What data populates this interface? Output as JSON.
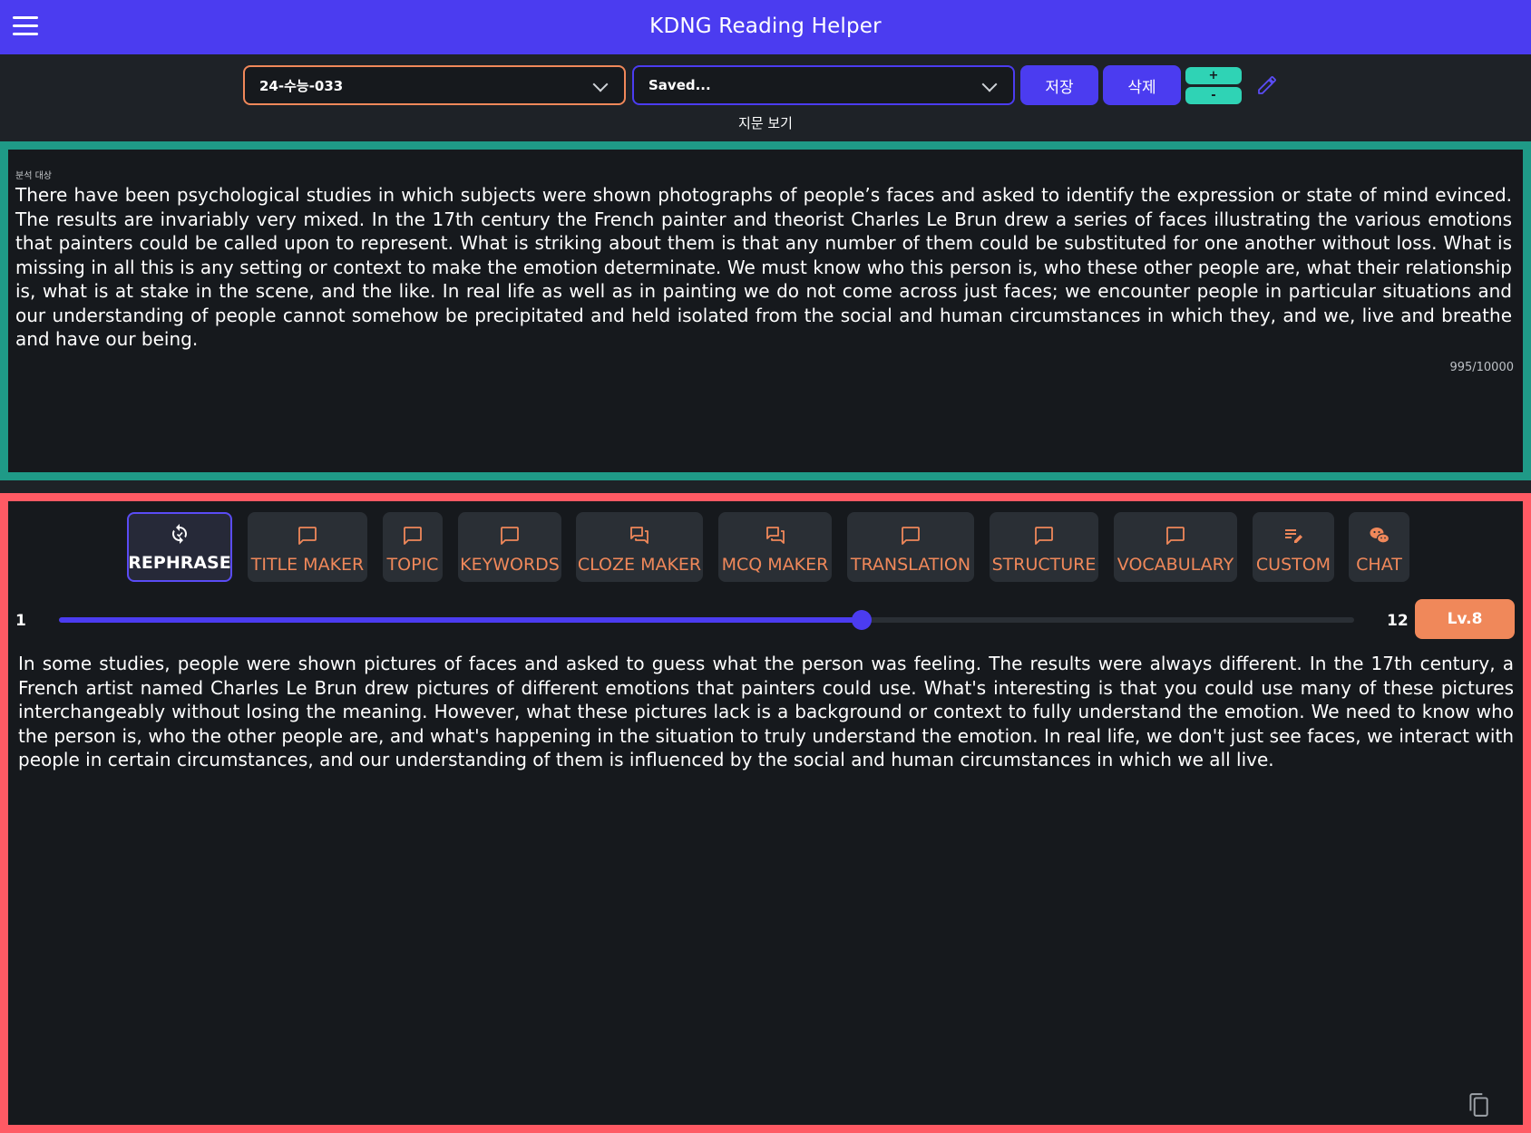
{
  "header": {
    "title": "KDNG Reading Helper",
    "menu_icon": "hamburger-menu-icon"
  },
  "toolbar": {
    "passage_select": {
      "value": "24-수능-033"
    },
    "saved_select": {
      "value": "Saved..."
    },
    "save_label": "저장",
    "delete_label": "삭제",
    "increase_label": "+",
    "decrease_label": "-",
    "edit_icon": "pencil-icon",
    "view_passage_label": "지문 보기"
  },
  "source": {
    "label": "분석 대상",
    "text": "There have been psychological studies in which subjects were shown photographs of people’s faces and asked to identify the expression or state of mind evinced. The results are invariably very mixed. In the 17th century the French painter and theorist Charles Le Brun drew a series of faces illustrating the various emotions that painters could be called upon to represent. What is striking about them is that any number of them could be substituted for one another without loss. What is missing in all this is any setting or context to make the emotion determinate. We must know who this person is, who these other people are, what their relationship is, what is at stake in the scene, and the like. In real life as well as in painting we do not come across just faces; we encounter people in particular situations and our understanding of people cannot somehow be precipitated and held isolated from the social and human circumstances in which they, and we, live and breathe and have our being.",
    "char_count": "995/10000"
  },
  "tabs": [
    {
      "label": "REPHRASE",
      "icon": "rephrase-sync-icon",
      "active": true
    },
    {
      "label": "TITLE MAKER",
      "icon": "chat-bubble-icon",
      "active": false
    },
    {
      "label": "TOPIC",
      "icon": "chat-bubble-icon",
      "active": false
    },
    {
      "label": "KEYWORDS",
      "icon": "chat-bubble-icon",
      "active": false
    },
    {
      "label": "CLOZE MAKER",
      "icon": "forum-icon",
      "active": false
    },
    {
      "label": "MCQ MAKER",
      "icon": "forum-icon",
      "active": false
    },
    {
      "label": "TRANSLATION",
      "icon": "chat-bubble-icon",
      "active": false
    },
    {
      "label": "STRUCTURE",
      "icon": "chat-bubble-icon",
      "active": false
    },
    {
      "label": "VOCABULARY",
      "icon": "chat-bubble-icon",
      "active": false
    },
    {
      "label": "CUSTOM",
      "icon": "edit-note-icon",
      "active": false
    },
    {
      "label": "CHAT",
      "icon": "wechat-icon",
      "active": false
    }
  ],
  "level_slider": {
    "min_label": "1",
    "max_label": "12",
    "min": 1,
    "max": 12,
    "value": 8,
    "badge": "Lv.8"
  },
  "output": {
    "text": "In some studies, people were shown pictures of faces and asked to guess what the person was feeling. The results were always different. In the 17th century, a French artist named Charles Le Brun drew pictures of different emotions that painters could use. What's interesting is that you could use many of these pictures interchangeably without losing the meaning. However, what these pictures lack is a background or context to fully understand the emotion. We need to know who the person is, who the other people are, and what's happening in the situation to truly understand the emotion. In real life, we don't just see faces, we interact with people in certain circumstances, and our understanding of them is influenced by the social and human circumstances in which we all live.",
    "copy_icon": "copy-icon"
  },
  "colors": {
    "brand": "#4b3cf0",
    "accent_orange": "#f0885a",
    "teal": "#1f9a87",
    "red": "#ff5a64",
    "background": "#16191d"
  }
}
